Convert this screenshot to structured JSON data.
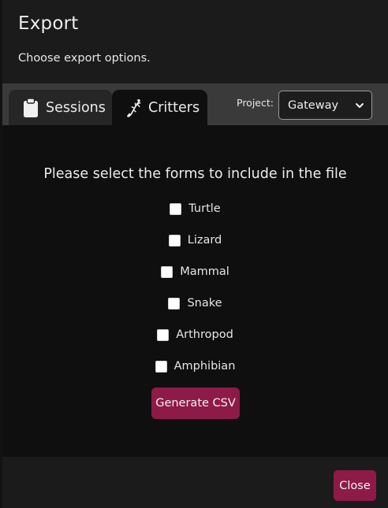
{
  "dialog": {
    "title": "Export",
    "subtitle": "Choose export options."
  },
  "tabs": [
    {
      "label": "Sessions",
      "icon": "clipboard-icon",
      "active": false
    },
    {
      "label": "Critters",
      "icon": "lizard-icon",
      "active": true
    }
  ],
  "project": {
    "label": "Project:",
    "selected": "Gateway"
  },
  "form": {
    "prompt": "Please select the forms to include in the file",
    "options": [
      {
        "label": "Turtle",
        "checked": false
      },
      {
        "label": "Lizard",
        "checked": false
      },
      {
        "label": "Mammal",
        "checked": false
      },
      {
        "label": "Snake",
        "checked": false
      },
      {
        "label": "Arthropod",
        "checked": false
      },
      {
        "label": "Amphibian",
        "checked": false
      }
    ],
    "generate_label": "Generate CSV"
  },
  "footer": {
    "close_label": "Close"
  },
  "colors": {
    "accent": "#8e1a47",
    "tab_active": "#0f0f0f",
    "tab_inactive": "#262626",
    "tabbar": "#3a3a3a"
  }
}
